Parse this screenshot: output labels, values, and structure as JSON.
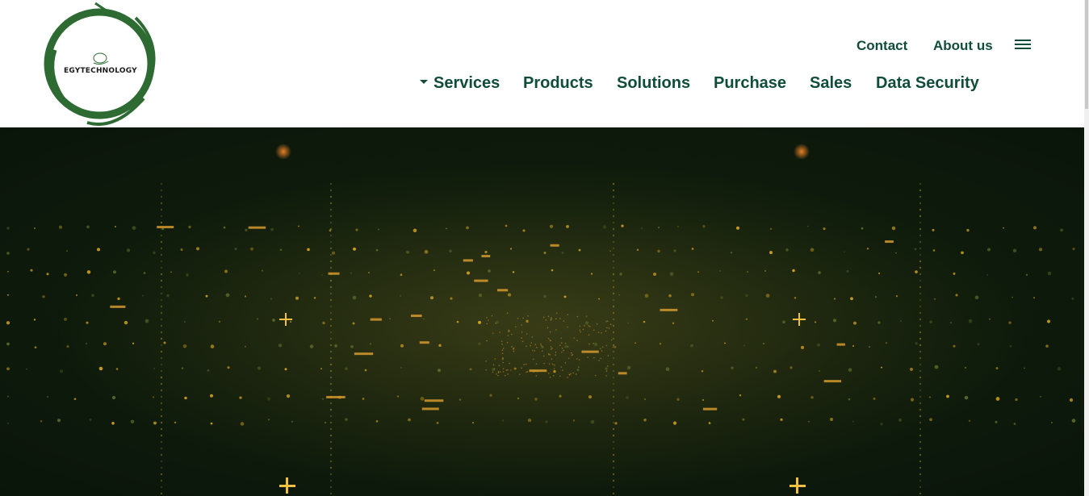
{
  "logo": {
    "text": "EGYTECHNOLOGY",
    "ring_color": "#2e6b32"
  },
  "top_nav": [
    {
      "label": "Contact"
    },
    {
      "label": "About us"
    }
  ],
  "menu": {
    "icon": "hamburger-menu-icon"
  },
  "main_nav": [
    {
      "label": "Services",
      "has_dropdown": true
    },
    {
      "label": "Products"
    },
    {
      "label": "Solutions"
    },
    {
      "label": "Purchase"
    },
    {
      "label": "Sales"
    },
    {
      "label": "Data Security"
    }
  ],
  "colors": {
    "nav_text": "#0f4d3a",
    "hero_bg": "#0f1d0c",
    "hero_dots": "#d9a520"
  }
}
